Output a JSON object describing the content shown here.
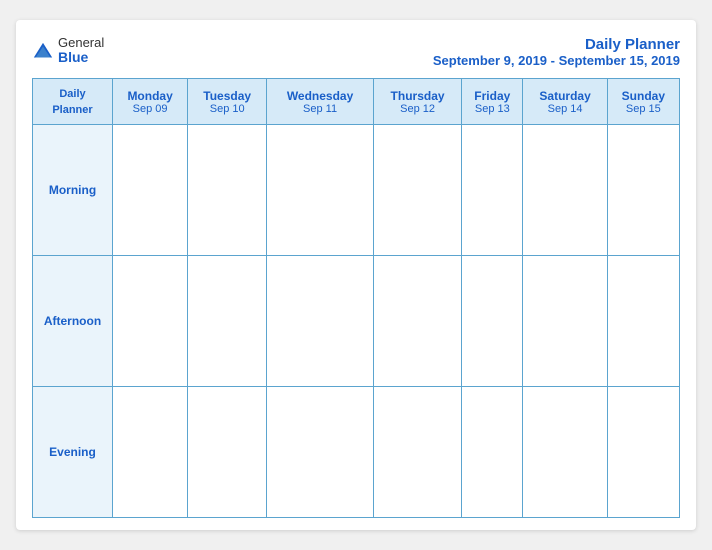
{
  "logo": {
    "general": "General",
    "blue": "Blue",
    "icon_color": "#1a5fc8"
  },
  "title": {
    "main": "Daily Planner",
    "sub": "September 9, 2019 - September 15, 2019"
  },
  "header_col1": {
    "line1": "Daily",
    "line2": "Planner"
  },
  "columns": [
    {
      "day": "Monday",
      "date": "Sep 09"
    },
    {
      "day": "Tuesday",
      "date": "Sep 10"
    },
    {
      "day": "Wednesday",
      "date": "Sep 11"
    },
    {
      "day": "Thursday",
      "date": "Sep 12"
    },
    {
      "day": "Friday",
      "date": "Sep 13"
    },
    {
      "day": "Saturday",
      "date": "Sep 14"
    },
    {
      "day": "Sunday",
      "date": "Sep 15"
    }
  ],
  "rows": [
    {
      "label": "Morning"
    },
    {
      "label": "Afternoon"
    },
    {
      "label": "Evening"
    }
  ]
}
